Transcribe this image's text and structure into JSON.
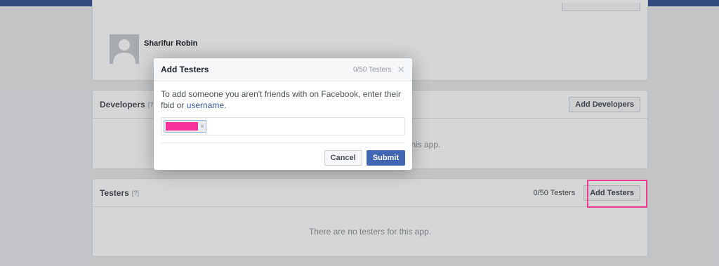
{
  "page": {
    "user_name": "Sharifur Robin",
    "developers": {
      "title": "Developers",
      "help": "[?]",
      "button": "Add Developers",
      "empty_tail": "this app."
    },
    "testers": {
      "title": "Testers",
      "help": "[?]",
      "count": "0/50 Testers",
      "button": "Add Testers",
      "empty": "There are no testers for this app."
    }
  },
  "dialog": {
    "title": "Add Testers",
    "count": "0/50 Testers",
    "close_icon": "close-icon",
    "description_prefix": "To add someone you aren't friends with on Facebook, enter their fbid or ",
    "description_link": "username",
    "description_suffix": ".",
    "token_remove": "×",
    "cancel_label": "Cancel",
    "submit_label": "Submit"
  },
  "colors": {
    "topbar": "#3b5998",
    "primary_button": "#4267b2",
    "highlight": "#f03a8f",
    "token_redaction": "#f5319a"
  }
}
